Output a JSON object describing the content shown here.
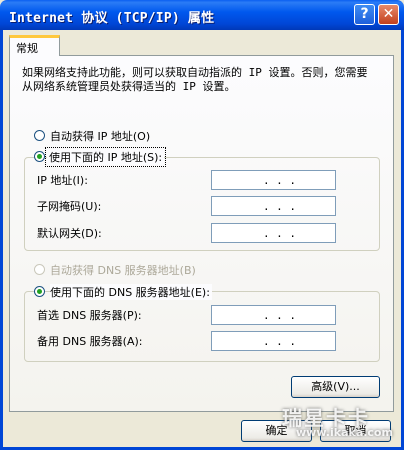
{
  "window": {
    "title": "Internet 协议 (TCP/IP) 属性",
    "help_icon": "?",
    "close_icon": "✕"
  },
  "tab": {
    "label": "常规"
  },
  "description": "如果网络支持此功能，则可以获取自动指派的 IP 设置。否则，您需要从网络系统管理员处获得适当的 IP 设置。",
  "ip_options": {
    "auto_label": "自动获得 IP 地址(O)",
    "manual_label": "使用下面的 IP 地址(S):",
    "selected": "manual"
  },
  "ip_fields": [
    {
      "label": "IP 地址(I):",
      "value": ". . ."
    },
    {
      "label": "子网掩码(U):",
      "value": ". . ."
    },
    {
      "label": "默认网关(D):",
      "value": ". . ."
    }
  ],
  "dns_options": {
    "auto_label": "自动获得 DNS 服务器地址(B)",
    "manual_label": "使用下面的 DNS 服务器地址(E):",
    "selected": "manual"
  },
  "dns_fields": [
    {
      "label": "首选 DNS 服务器(P):",
      "value": ". . ."
    },
    {
      "label": "备用 DNS 服务器(A):",
      "value": ". . ."
    }
  ],
  "buttons": {
    "advanced": "高级(V)...",
    "ok": "确定",
    "cancel": "取消"
  },
  "watermark": {
    "text": "瑞星卡卡",
    "url": "www.ikaka.com"
  },
  "colors": {
    "title_bar": "#0058ee",
    "radio_dot": "#21a121",
    "field_border": "#7f9db9",
    "dialog_bg": "#ece9d8"
  }
}
